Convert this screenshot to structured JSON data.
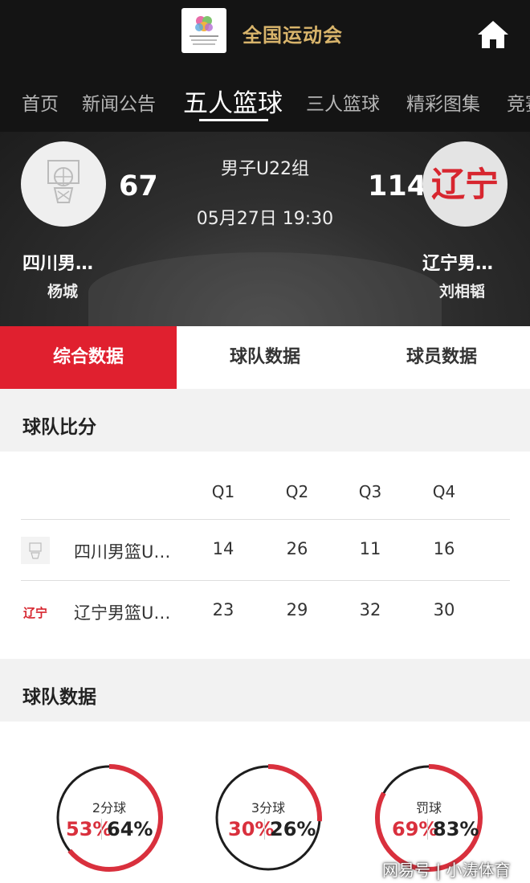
{
  "header": {
    "title": "全国运动会",
    "logo_icon": "national-games-logo",
    "home_icon": "home-icon"
  },
  "nav": {
    "tabs": [
      "首页",
      "新闻公告",
      "五人篮球",
      "三人篮球",
      "精彩图集",
      "竞赛"
    ],
    "active_index": 2
  },
  "match": {
    "group": "男子U22组",
    "time": "05月27日 19:30",
    "home": {
      "name": "四川男…",
      "score": "67",
      "coach": "杨城"
    },
    "away": {
      "name": "辽宁男…",
      "score": "114",
      "coach": "刘相韬",
      "logo_text": "辽宁"
    }
  },
  "subtabs": {
    "items": [
      "综合数据",
      "球队数据",
      "球员数据"
    ],
    "active_index": 0
  },
  "team_score": {
    "title": "球队比分",
    "headers": [
      "Q1",
      "Q2",
      "Q3",
      "Q4"
    ],
    "rows": [
      {
        "name": "四川男篮U…",
        "q": [
          "14",
          "26",
          "11",
          "16"
        ]
      },
      {
        "name": "辽宁男篮U…",
        "q": [
          "23",
          "29",
          "32",
          "30"
        ],
        "logo_text": "辽宁"
      }
    ]
  },
  "team_stats": {
    "title": "球队数据",
    "items": [
      {
        "label": "2分球",
        "home": "53%",
        "away": "64%",
        "home_value": 0.53,
        "away_value": 0.64
      },
      {
        "label": "3分球",
        "home": "30%",
        "away": "26%",
        "home_value": 0.3,
        "away_value": 0.26
      },
      {
        "label": "罚球",
        "home": "69%",
        "away": "83%",
        "home_value": 0.69,
        "away_value": 0.83
      }
    ]
  },
  "watermark": "网易号 | 小涛体育",
  "colors": {
    "accent_red": "#e0202f",
    "gold": "#d8b46b",
    "dark_bg": "#141414"
  }
}
